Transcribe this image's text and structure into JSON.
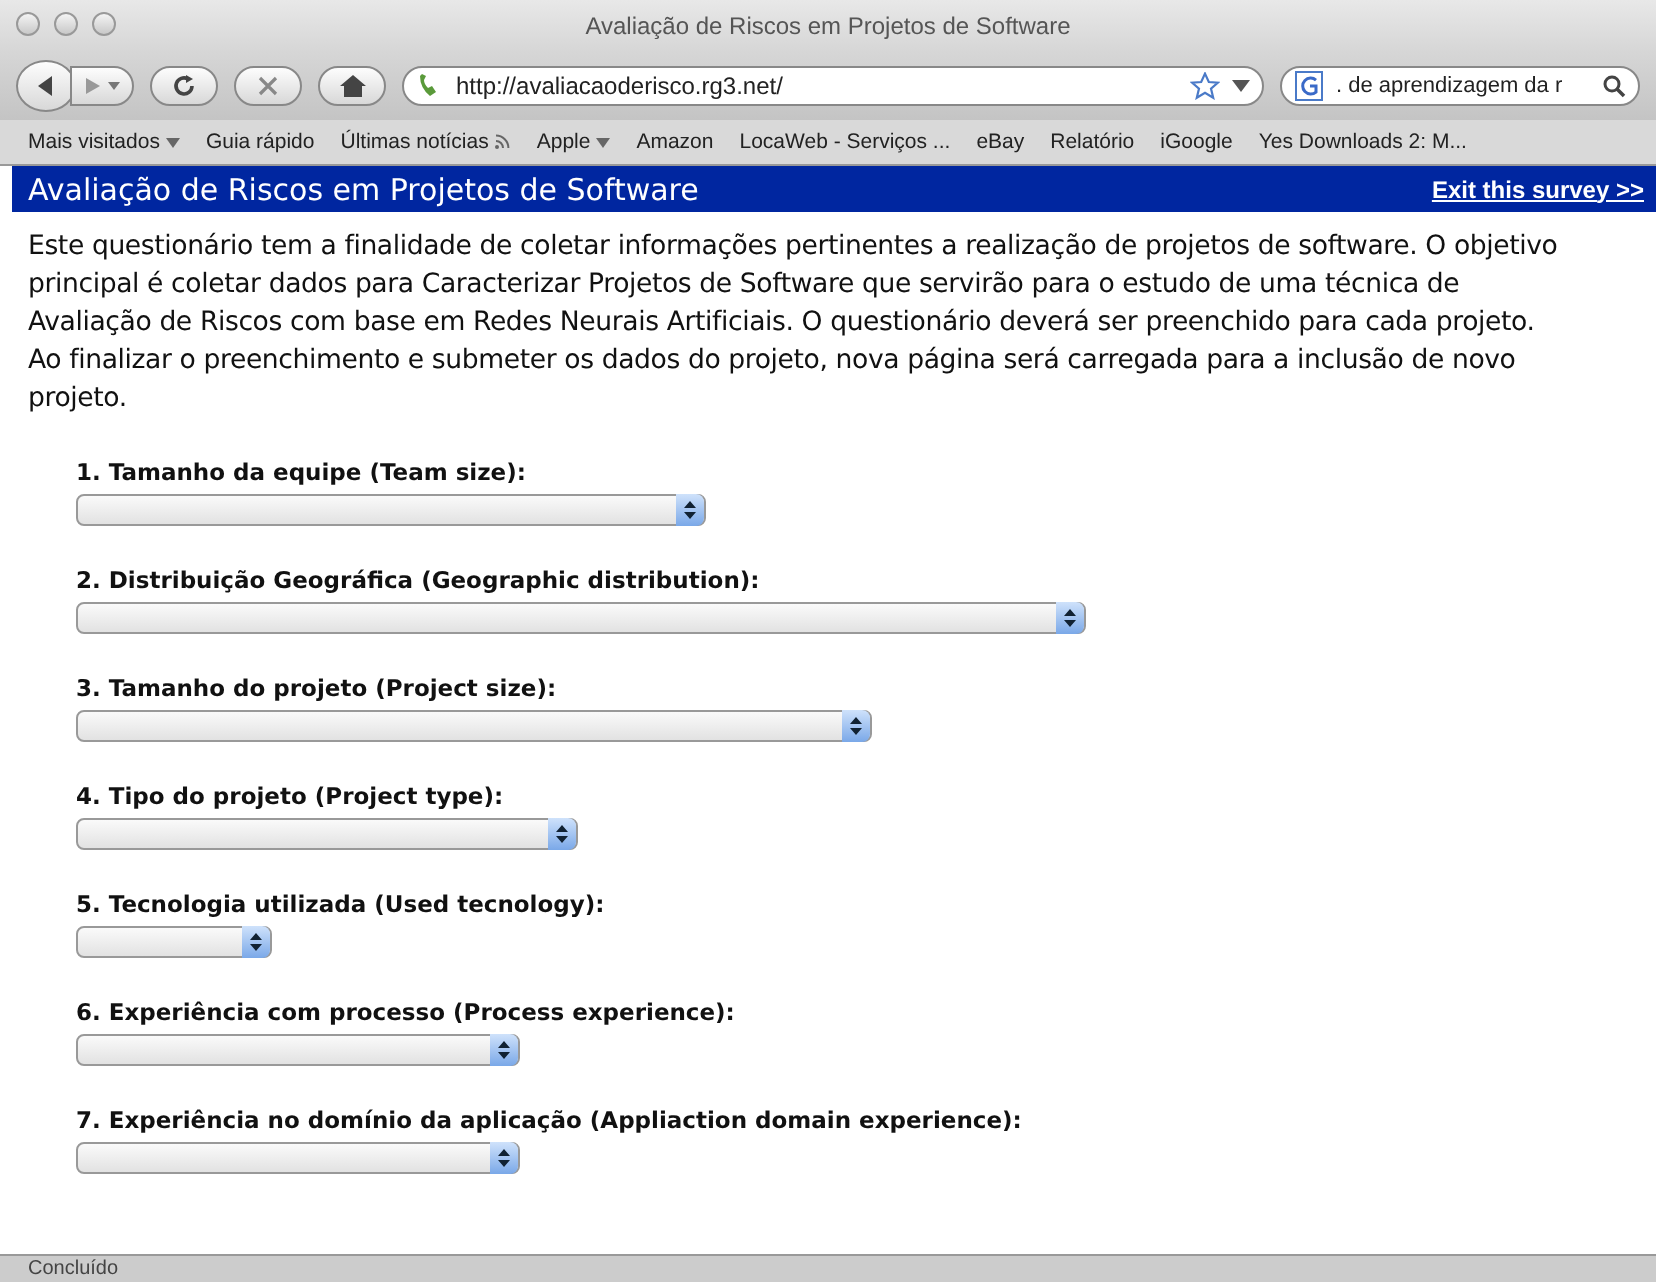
{
  "window": {
    "title": "Avaliação de Riscos em Projetos de Software"
  },
  "toolbar": {
    "url": "http://avaliacaoderisco.rg3.net/",
    "search_value": ". de aprendizagem da r"
  },
  "bookmarks": [
    {
      "label": "Mais visitados",
      "menu": true,
      "feed": false
    },
    {
      "label": "Guia rápido",
      "menu": false,
      "feed": false
    },
    {
      "label": "Últimas notícias",
      "menu": false,
      "feed": true
    },
    {
      "label": "Apple",
      "menu": true,
      "feed": false
    },
    {
      "label": "Amazon",
      "menu": false,
      "feed": false
    },
    {
      "label": "LocaWeb - Serviços ...",
      "menu": false,
      "feed": false
    },
    {
      "label": "eBay",
      "menu": false,
      "feed": false
    },
    {
      "label": "Relatório",
      "menu": false,
      "feed": false
    },
    {
      "label": "iGoogle",
      "menu": false,
      "feed": false
    },
    {
      "label": "Yes Downloads 2: M...",
      "menu": false,
      "feed": false
    }
  ],
  "header": {
    "title": "Avaliação de Riscos em Projetos de Software",
    "exit_link": "Exit this survey >>"
  },
  "intro": "Este questionário tem a finalidade de coletar informações pertinentes a realização de projetos de software. O objetivo principal é coletar dados para Caracterizar Projetos de Software que servirão para o estudo de uma técnica de Avaliação de Riscos com base em Redes Neurais Artificiais. O questionário deverá ser preenchido para cada projeto. Ao finalizar o preenchimento e submeter os dados do projeto, nova página será carregada para a inclusão de novo projeto.",
  "questions": [
    {
      "label": "1. Tamanho da equipe (Team size):"
    },
    {
      "label": "2. Distribuição Geográfica (Geographic distribution):"
    },
    {
      "label": "3. Tamanho do projeto (Project size):"
    },
    {
      "label": "4. Tipo do projeto (Project type):"
    },
    {
      "label": "5. Tecnologia utilizada (Used tecnology):"
    },
    {
      "label": "6. Experiência com processo (Process experience):"
    },
    {
      "label": "7. Experiência no domínio da aplicação (Appliaction domain experience):"
    }
  ],
  "status_bar": "Concluído"
}
